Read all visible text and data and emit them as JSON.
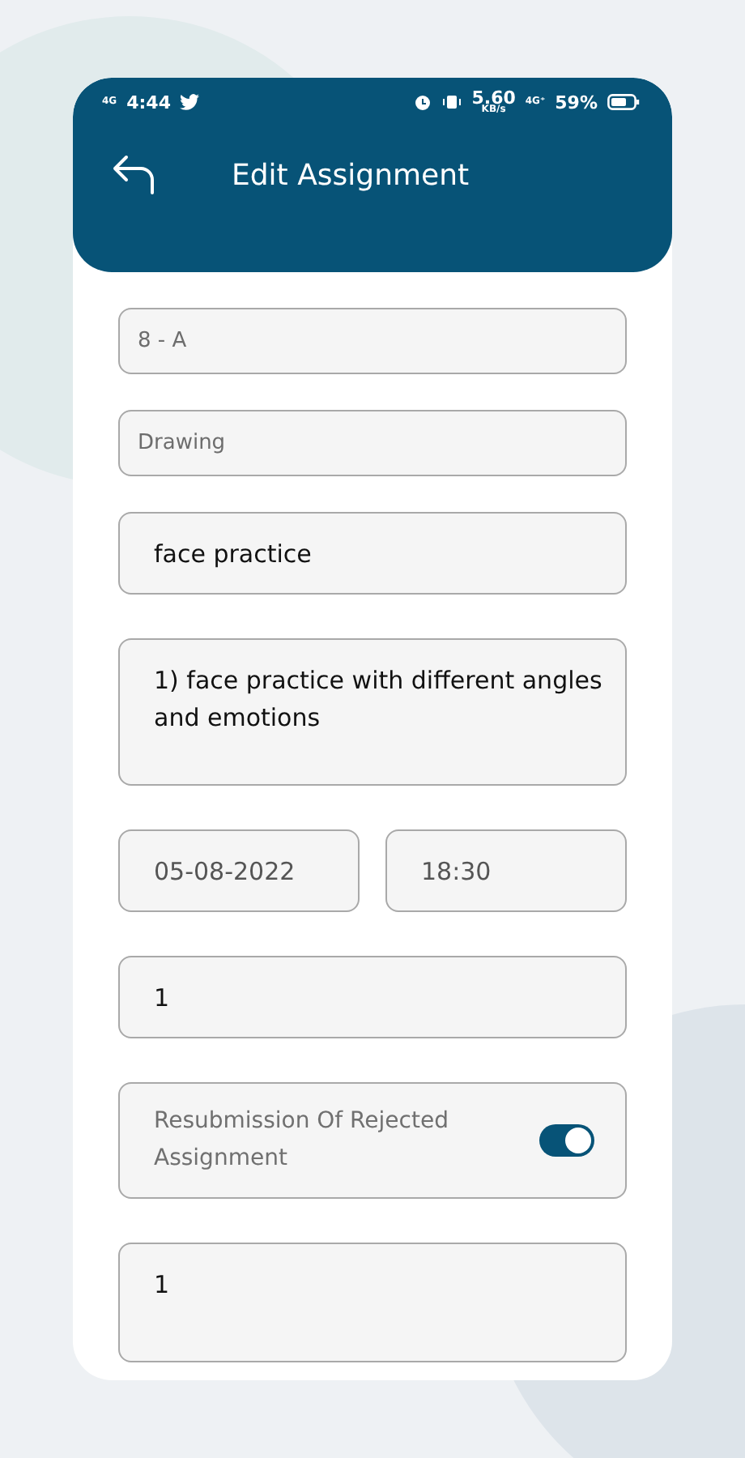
{
  "status_bar": {
    "network": "4G",
    "time": "4:44",
    "speed": "5.60",
    "speed_unit": "KB/s",
    "network_2": "4G⁺",
    "battery": "59%"
  },
  "header": {
    "title": "Edit Assignment"
  },
  "fields": [
    {
      "kind": "readonly",
      "value": "8 - A"
    },
    {
      "kind": "readonly",
      "value": "Drawing"
    },
    {
      "kind": "input",
      "value": "face practice"
    },
    {
      "kind": "textarea",
      "value": "1) face practice with different angles and emotions"
    },
    {
      "kind": "pair",
      "values": [
        "05-08-2022",
        "18:30"
      ]
    },
    {
      "kind": "input",
      "value": "1"
    },
    {
      "kind": "toggle",
      "label": "Resubmission Of Rejected Assignment",
      "on": true
    },
    {
      "kind": "textarea-short",
      "value": "1"
    }
  ]
}
